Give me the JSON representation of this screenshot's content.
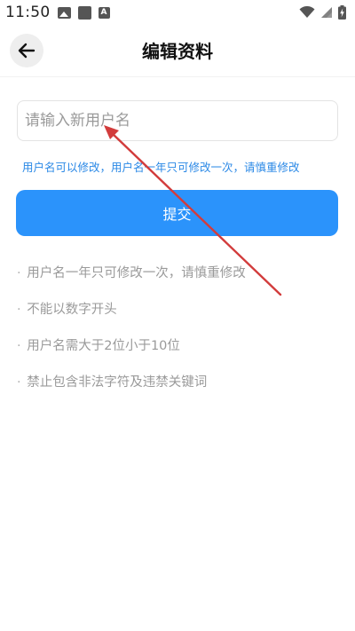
{
  "status_bar": {
    "time": "11:50",
    "icons": [
      "gallery-icon",
      "square-icon",
      "a-icon",
      "wifi-icon",
      "signal-icon",
      "battery-charging-icon"
    ]
  },
  "header": {
    "back_icon": "arrow-left-icon",
    "title": "编辑资料"
  },
  "form": {
    "username_placeholder": "请输入新用户名",
    "username_value": "",
    "hint": "用户名可以修改，用户名一年只可修改一次，请慎重修改",
    "submit_label": "提交"
  },
  "rules": {
    "bullet": "·",
    "items": [
      "用户名一年只可修改一次，请慎重修改",
      "不能以数字开头",
      "用户名需大于2位小于10位",
      "禁止包含非法字符及违禁关键词"
    ]
  },
  "colors": {
    "accent": "#2b93fb",
    "hint": "#2a88e6",
    "muted": "#9a9a9a",
    "annotation_arrow": "#d23c3c"
  }
}
